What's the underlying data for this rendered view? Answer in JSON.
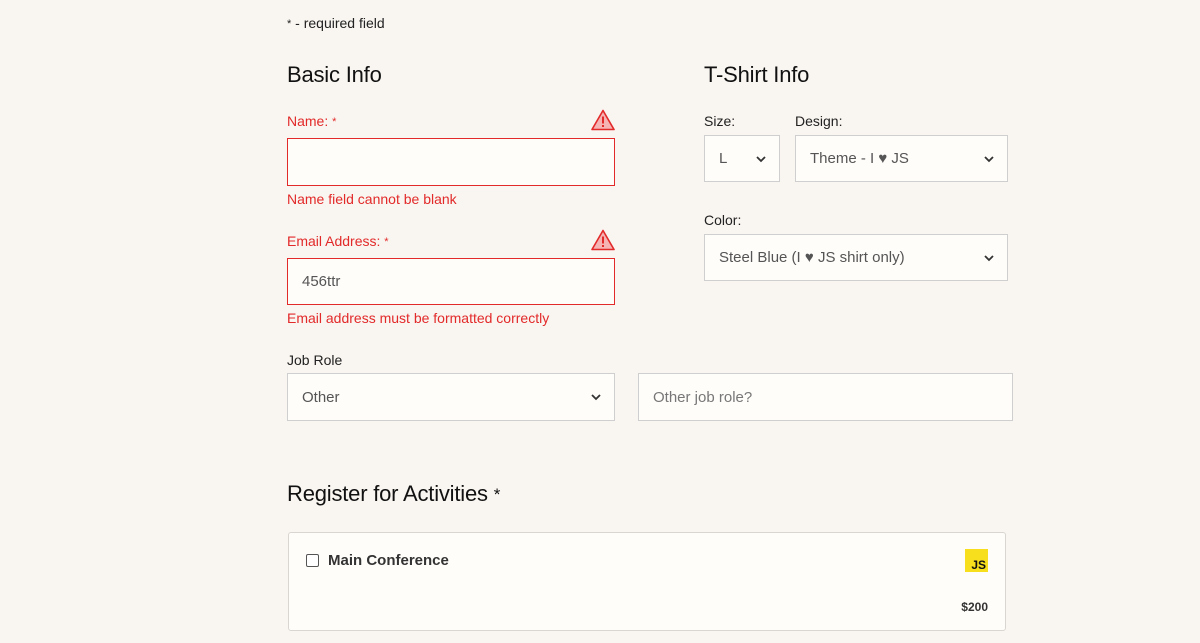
{
  "required_note": {
    "star": "*",
    "text": " - required field"
  },
  "basic_info": {
    "heading": "Basic Info",
    "name": {
      "label": "Name: ",
      "star": "*",
      "value": "",
      "error": "Name field cannot be blank"
    },
    "email": {
      "label": "Email Address: ",
      "star": "*",
      "value": "456ttr",
      "error": "Email address must be formatted correctly"
    },
    "job_role": {
      "label": "Job Role",
      "selected": "Other",
      "other_placeholder": "Other job role?"
    }
  },
  "tshirt_info": {
    "heading": "T-Shirt Info",
    "size": {
      "label": "Size:",
      "selected": "L"
    },
    "design": {
      "label": "Design:",
      "selected": "Theme - I ♥ JS"
    },
    "color": {
      "label": "Color:",
      "selected": "Steel Blue (I ♥ JS shirt only)"
    }
  },
  "activities": {
    "heading": "Register for Activities ",
    "star": "*",
    "items": [
      {
        "name": "Main Conference",
        "logo_text": "JS",
        "price": "$200",
        "checked": false
      }
    ]
  },
  "colors": {
    "error": "#e22a2a",
    "background": "#f9f5f0",
    "js_yellow": "#f7df1e"
  },
  "icons": {
    "warning": "warning-triangle-icon",
    "select": "chevron-down-icon",
    "logo": "js-logo-icon"
  }
}
